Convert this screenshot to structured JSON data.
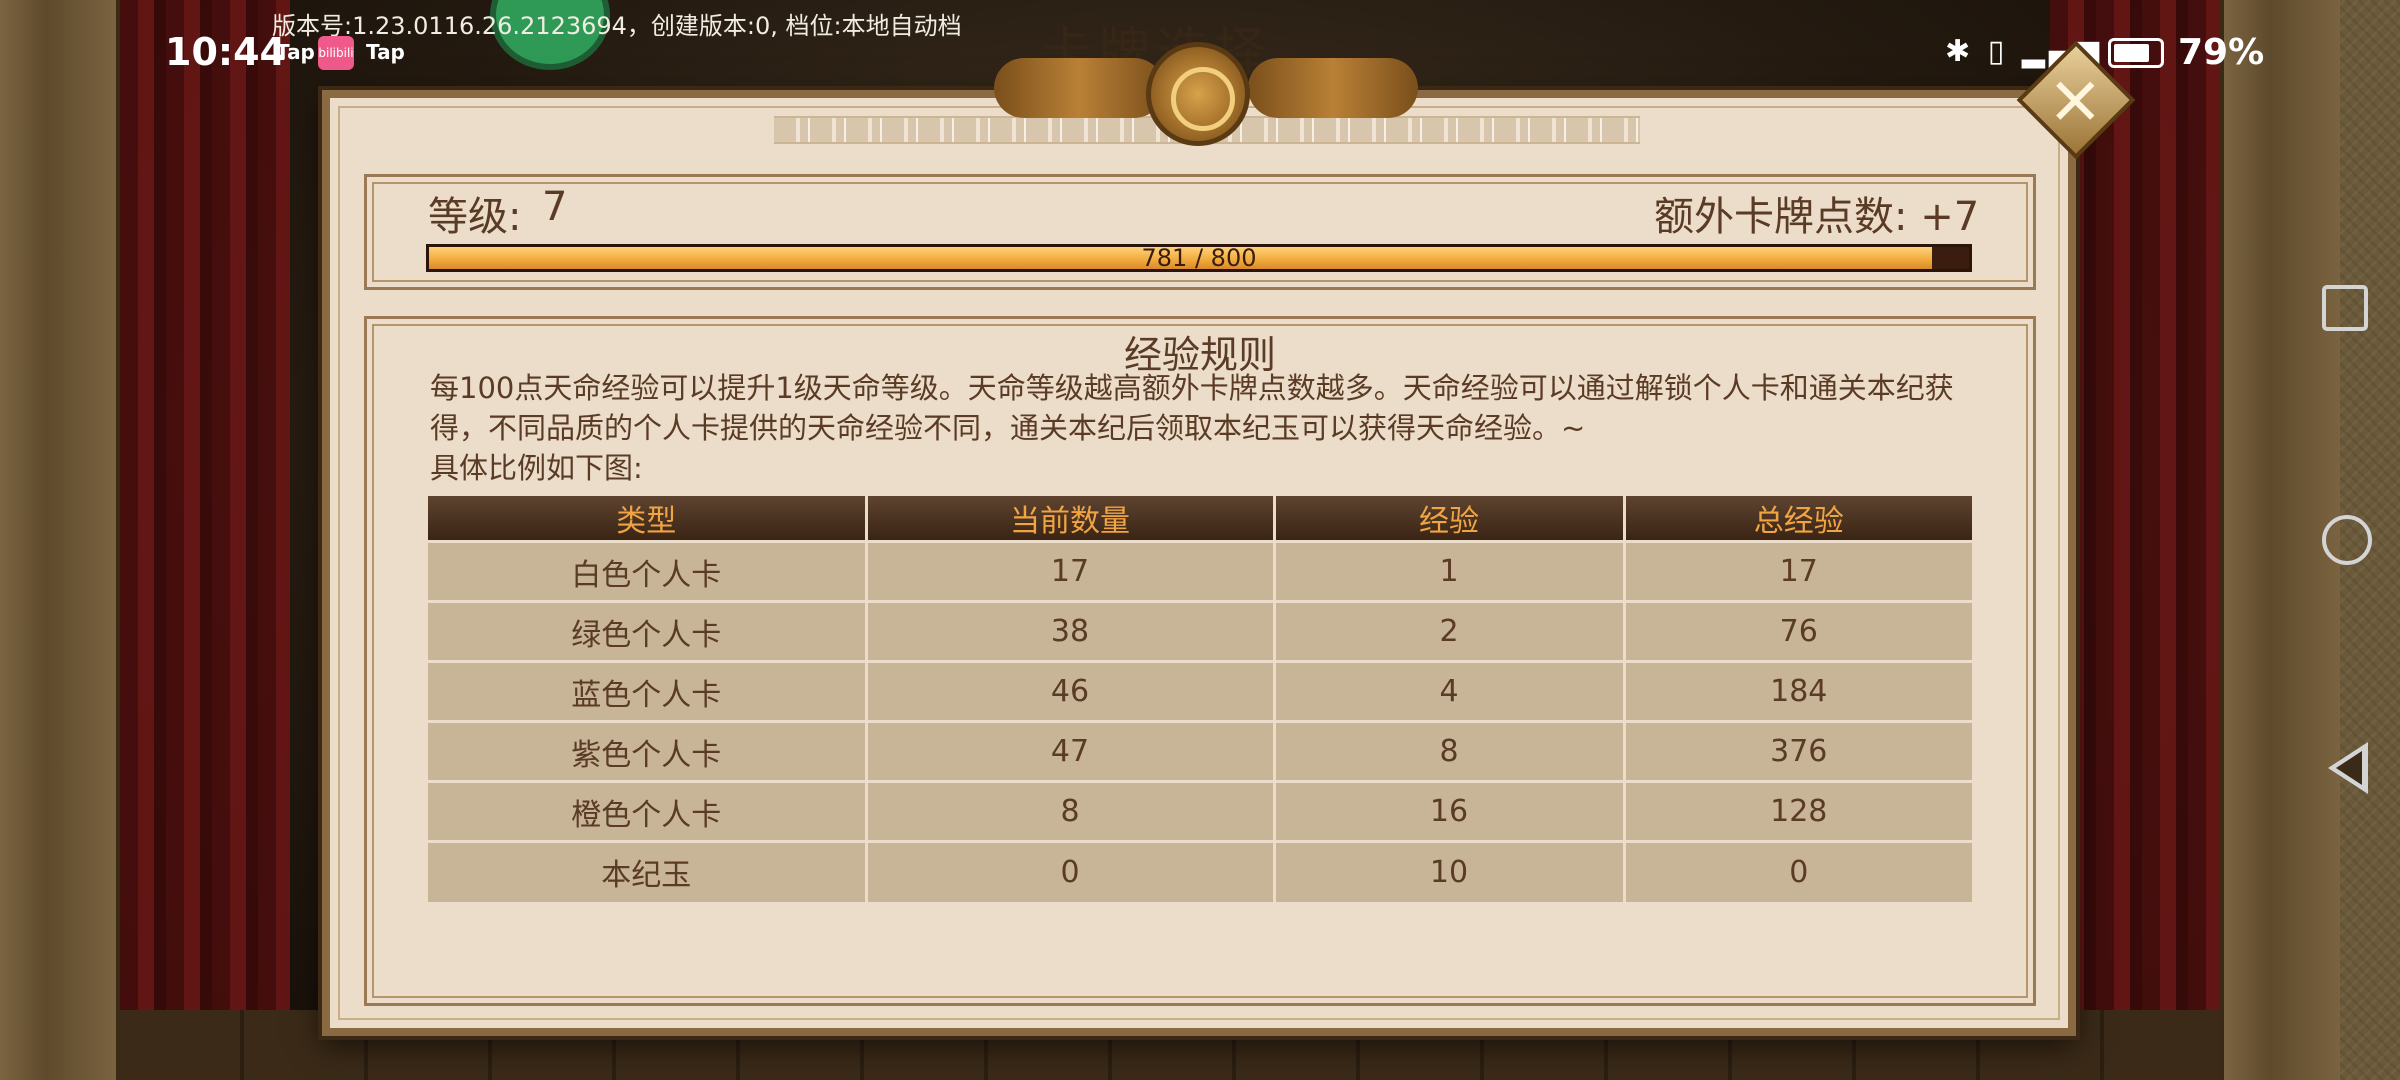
{
  "status_bar": {
    "time": "10:44",
    "app_badge_1": "Tap",
    "app_badge_bili": "bilibili",
    "app_badge_2": "Tap",
    "version_line": "版本号:1.23.0116.26.2123694，创建版本:0, 档位:本地自动档",
    "battery_percent": "79%",
    "battery_level": 0.79,
    "icons": [
      "bluetooth-icon",
      "vibrate-icon",
      "4g-icon",
      "signal-icon",
      "battery-icon"
    ]
  },
  "background": {
    "title": "卡牌选择"
  },
  "level_panel": {
    "level_label": "等级:",
    "level_value": "7",
    "extra_points_label": "额外卡牌点数: +7",
    "progress_text": "781 / 800",
    "progress_current": 781,
    "progress_max": 800
  },
  "rules": {
    "title": "经验规则",
    "paragraph": "每100点天命经验可以提升1级天命等级。天命等级越高额外卡牌点数越多。天命经验可以通过解锁个人卡和通关本纪获得，不同品质的个人卡提供的天命经验不同，通关本纪后领取本纪玉可以获得天命经验。~",
    "subline": "具体比例如下图:"
  },
  "table": {
    "headers": [
      "类型",
      "当前数量",
      "经验",
      "总经验"
    ],
    "rows": [
      [
        "白色个人卡",
        "17",
        "1",
        "17"
      ],
      [
        "绿色个人卡",
        "38",
        "2",
        "76"
      ],
      [
        "蓝色个人卡",
        "46",
        "4",
        "184"
      ],
      [
        "紫色个人卡",
        "47",
        "8",
        "376"
      ],
      [
        "橙色个人卡",
        "8",
        "16",
        "128"
      ],
      [
        "本纪玉",
        "0",
        "10",
        "0"
      ]
    ]
  },
  "colors": {
    "header_text": "#f0a443",
    "body_text": "#5a3b25",
    "progress_fill": "#f0a93b",
    "panel_bg": "#ecddca"
  }
}
